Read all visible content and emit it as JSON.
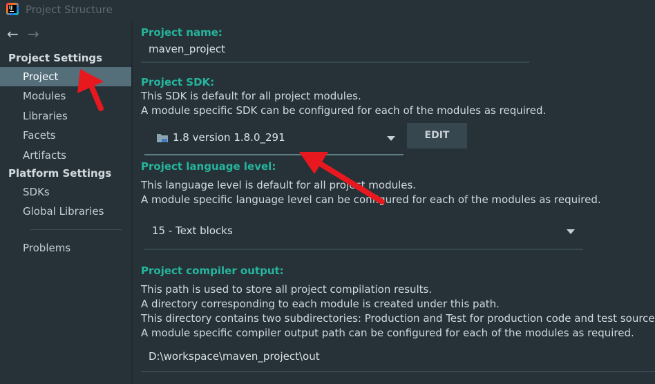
{
  "window": {
    "title": "Project Structure",
    "app_icon_text": "IJ"
  },
  "nav": {
    "back_icon": "←",
    "forward_icon": "→"
  },
  "sidebar": {
    "project_settings_header": "Project Settings",
    "project_settings_items": [
      {
        "label": "Project",
        "selected": true
      },
      {
        "label": "Modules"
      },
      {
        "label": "Libraries"
      },
      {
        "label": "Facets"
      },
      {
        "label": "Artifacts"
      }
    ],
    "platform_settings_header": "Platform Settings",
    "platform_settings_items": [
      {
        "label": "SDKs"
      },
      {
        "label": "Global Libraries"
      }
    ],
    "problems_label": "Problems"
  },
  "main": {
    "project_name": {
      "label": "Project name:",
      "value": "maven_project"
    },
    "project_sdk": {
      "label": "Project SDK:",
      "desc_1": "This SDK is default for all project modules.",
      "desc_2": "A module specific SDK can be configured for each of the modules as required.",
      "selected": "1.8 version 1.8.0_291",
      "edit_button": "EDIT"
    },
    "language_level": {
      "label": "Project language level:",
      "desc_1": "This language level is default for all project modules.",
      "desc_2": "A module specific language level can be configured for each of the modules as required.",
      "selected": "15 - Text blocks"
    },
    "compiler_output": {
      "label": "Project compiler output:",
      "desc_1": "This path is used to store all project compilation results.",
      "desc_2": "A directory corresponding to each module is created under this path.",
      "desc_3": "This directory contains two subdirectories: Production and Test for production code and test sources,",
      "desc_4": "A module specific compiler output path can be configured for each of the modules as required.",
      "value": "D:\\workspace\\maven_project\\out"
    }
  },
  "colors": {
    "background": "#263238",
    "selection": "#546e7a",
    "label_accent": "#26b59d",
    "annotation_arrow": "#e8181f"
  }
}
